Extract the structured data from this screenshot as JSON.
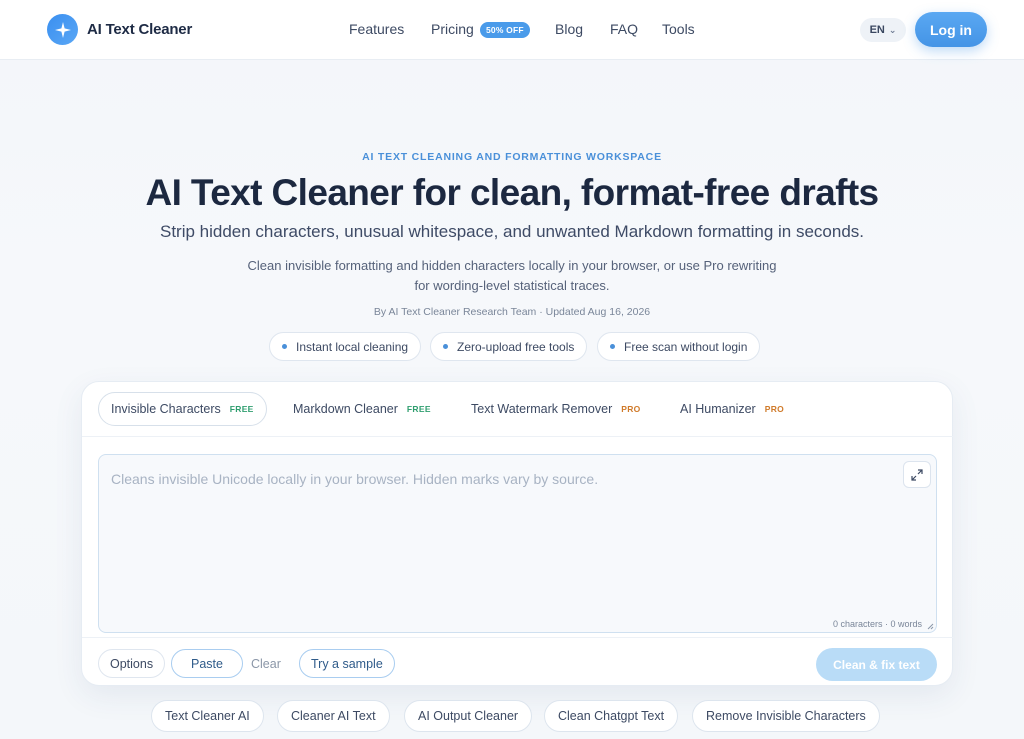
{
  "header": {
    "logo_text": "AI Text Cleaner",
    "nav": [
      "Features",
      "Pricing",
      "Blog",
      "FAQ",
      "Tools"
    ],
    "pricing_badge": "50% OFF",
    "language": "EN",
    "login_label": "Log in"
  },
  "hero": {
    "eyebrow": "AI TEXT CLEANING AND FORMATTING WORKSPACE",
    "title": "AI Text Cleaner for clean, format-free drafts",
    "subtitle": "Strip hidden characters, unusual whitespace, and unwanted Markdown formatting in seconds.",
    "description_line1": "Clean invisible formatting and hidden characters locally in your browser, or use Pro rewriting",
    "description_line2": "for wording-level statistical traces.",
    "byline": "By AI Text Cleaner Research Team · Updated Aug 16, 2026",
    "features": [
      "Instant local cleaning",
      "Zero-upload free tools",
      "Free scan without login"
    ]
  },
  "workspace": {
    "tabs": [
      {
        "label": "Invisible Characters",
        "tag": "FREE"
      },
      {
        "label": "Markdown Cleaner",
        "tag": "FREE"
      },
      {
        "label": "Text Watermark Remover",
        "tag": "PRO"
      },
      {
        "label": "AI Humanizer",
        "tag": "PRO"
      }
    ],
    "active_tab": "Invisible Characters",
    "editor_placeholder": "Cleans invisible Unicode locally in your browser. Hidden marks vary by source.",
    "editor_value": "",
    "counter": "0 characters · 0 words",
    "options_label": "Options",
    "paste_label": "Paste",
    "clear_label": "Clear",
    "sample_label": "Try a sample",
    "submit_label": "Clean & fix text"
  },
  "related_tools": [
    "Text Cleaner AI",
    "Cleaner AI Text",
    "AI Output Cleaner",
    "Clean Chatgpt Text",
    "Remove Invisible Characters"
  ],
  "colors": {
    "accent": "#4a9bea",
    "free_tag": "#2f9e6f",
    "pro_tag": "#d07a2a",
    "submit_disabled": "#b9dcf7"
  }
}
